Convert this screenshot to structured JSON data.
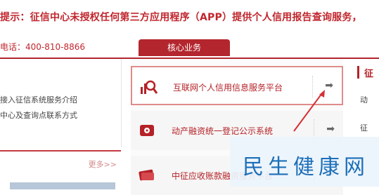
{
  "notice": {
    "text": "提示：征信中心未授权任何第三方应用程序（APP）提供个人信用报告查询服务，"
  },
  "phone": {
    "text": "电话：400-810-8866"
  },
  "tabs": {
    "core": "核心业务"
  },
  "left_panel": {
    "links": [
      "接入征信系统服务介绍",
      "中心及查询点联系方式"
    ],
    "more": "更多>>"
  },
  "services": [
    {
      "label": "互联网个人信用信息服务平台",
      "icon": "magnifier-chart-icon"
    },
    {
      "label": "动产融资统一登记公示系统",
      "icon": "vault-icon"
    },
    {
      "label": "中征应收账款融资服务平台",
      "icon": "banknote-icon"
    }
  ],
  "right_panel": {
    "title": "征",
    "items": [
      "动",
      "征"
    ]
  },
  "watermark": {
    "text": "民生健康网"
  },
  "colors": {
    "brand": "#b3262e",
    "notice": "#c0262d",
    "watermark": "#1d6fb8"
  }
}
